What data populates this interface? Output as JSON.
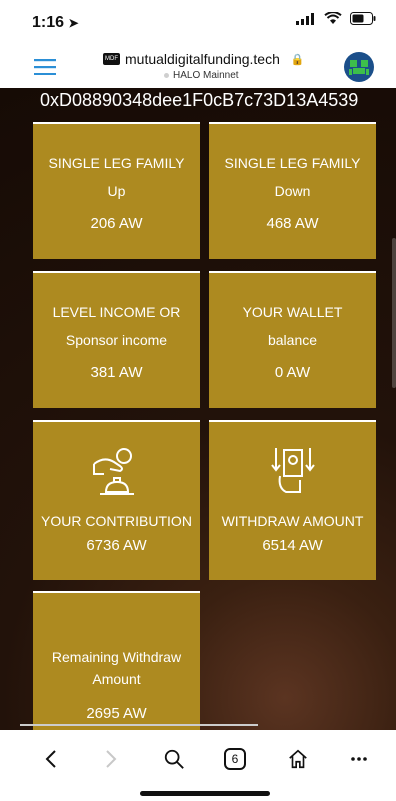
{
  "status": {
    "time": "1:16"
  },
  "browser": {
    "domain": "mutualdigitalfunding.tech",
    "favicon_text": "MDF",
    "network": "HALO Mainnet",
    "tab_count": "6"
  },
  "page": {
    "address": "0xD08890348dee1F0cB7c73D13A4539",
    "cards": [
      {
        "title": "SINGLE LEG FAMILY",
        "subtitle": "Up",
        "value": "206 AW"
      },
      {
        "title": "SINGLE LEG FAMILY",
        "subtitle": "Down",
        "value": "468 AW"
      },
      {
        "title": "LEVEL INCOME OR",
        "subtitle": "Sponsor income",
        "value": "381 AW"
      },
      {
        "title": "YOUR WALLET",
        "subtitle": "balance",
        "value": "0 AW"
      },
      {
        "title": "YOUR CONTRIBUTION",
        "value": "6736 AW",
        "icon": "hand-donation-icon"
      },
      {
        "title": "WITHDRAW AMOUNT",
        "value": "6514 AW",
        "icon": "cash-withdraw-icon"
      },
      {
        "title_line1": "Remaining Withdraw",
        "title_line2": "Amount",
        "value": "2695 AW"
      }
    ]
  },
  "colors": {
    "card": "#ad8a20",
    "background": "#1c0f07"
  }
}
